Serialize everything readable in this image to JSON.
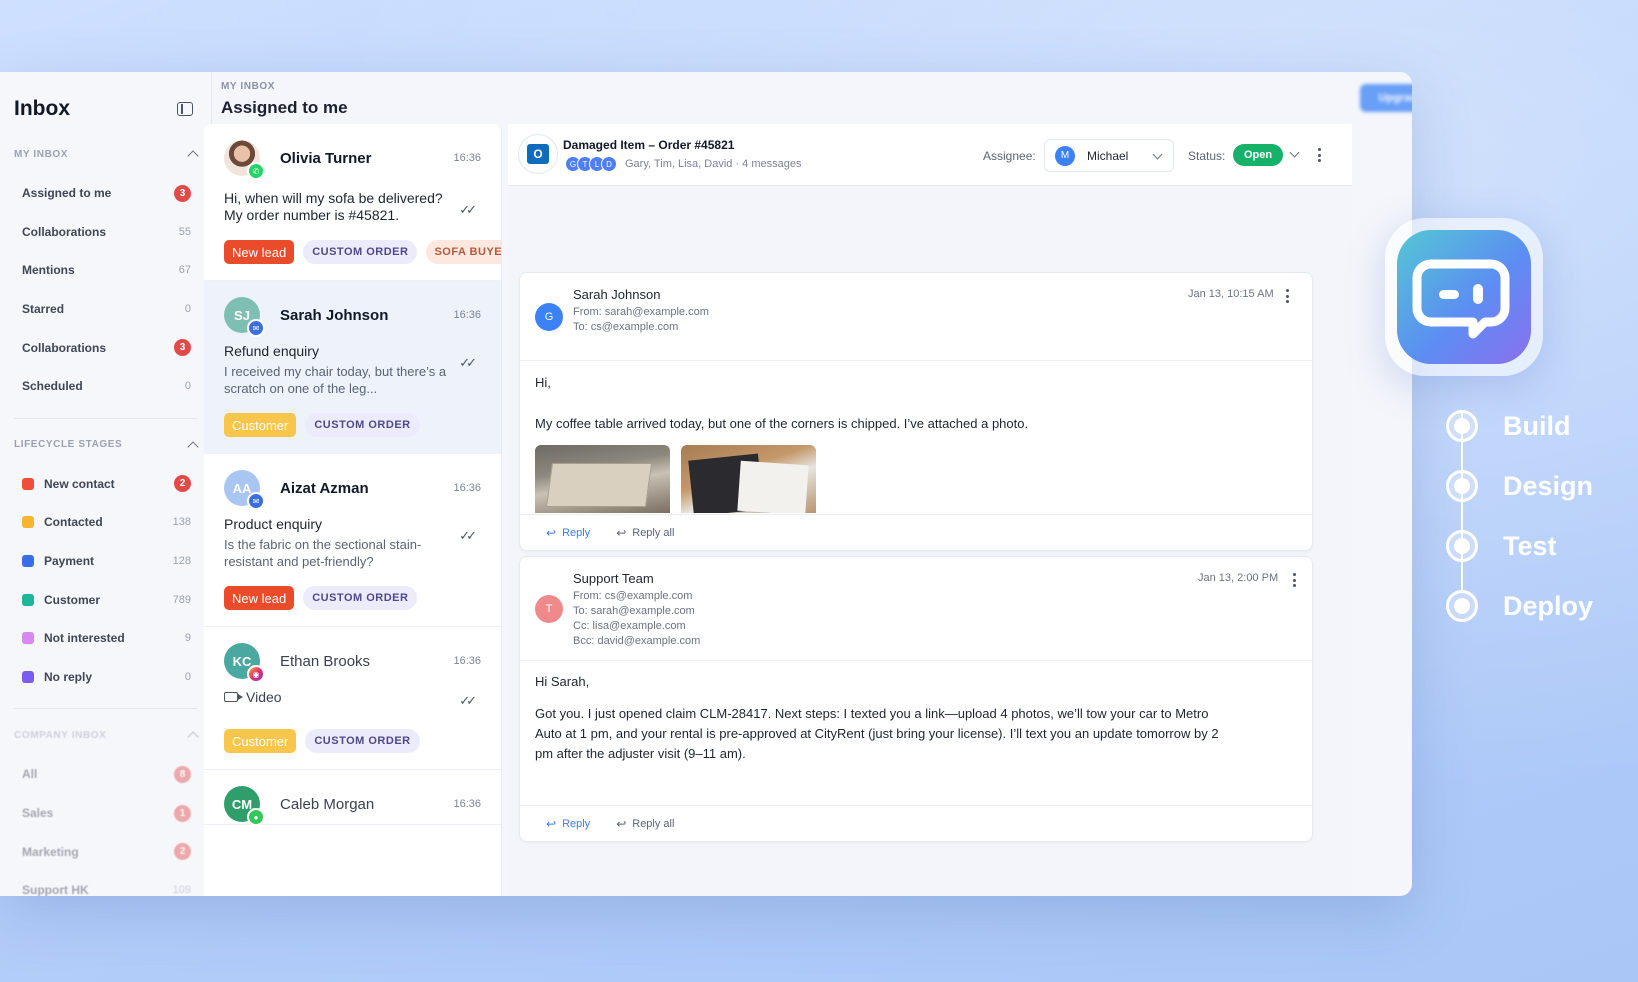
{
  "sidebar": {
    "title": "Inbox",
    "my_inbox": {
      "heading": "MY INBOX",
      "items": [
        {
          "label": "Assigned to me",
          "badge": "3"
        },
        {
          "label": "Collaborations",
          "count": "55"
        },
        {
          "label": "Mentions",
          "count": "67"
        },
        {
          "label": "Starred",
          "count": "0"
        },
        {
          "label": "Collaborations",
          "badge": "3"
        },
        {
          "label": "Scheduled",
          "count": "0"
        }
      ]
    },
    "lifecycle": {
      "heading": "LIFECYCLE STAGES",
      "items": [
        {
          "label": "New contact",
          "badge": "2",
          "color": "#ef4e3a"
        },
        {
          "label": "Contacted",
          "count": "138",
          "color": "#f6b531"
        },
        {
          "label": "Payment",
          "count": "128",
          "color": "#3a6ee8"
        },
        {
          "label": "Customer",
          "count": "789",
          "color": "#1fb59a"
        },
        {
          "label": "Not interested",
          "count": "9",
          "color": "#d68af0"
        },
        {
          "label": "No reply",
          "count": "0",
          "color": "#7b5cf0"
        }
      ]
    },
    "company_inbox": {
      "heading": "COMPANY INBOX",
      "items": [
        {
          "label": "All",
          "badge": "8"
        },
        {
          "label": "Sales",
          "badge": "1"
        },
        {
          "label": "Marketing",
          "badge": "2"
        },
        {
          "label": "Support HK",
          "count": "109"
        }
      ]
    }
  },
  "header": {
    "eyebrow": "MY INBOX",
    "title": "Assigned to me",
    "upgrade_label": "Upgrade Plan"
  },
  "conversations": [
    {
      "name": "Olivia Turner",
      "time": "16:36",
      "preview": "Hi, when will my sofa be delivered? My order number is #45821.",
      "tags": [
        "New lead",
        "CUSTOM ORDER",
        "SOFA BUYER"
      ],
      "channel": "whatsapp-icon"
    },
    {
      "name": "Sarah Johnson",
      "initials": "SJ",
      "time": "16:36",
      "subject": "Refund enquiry",
      "preview": "I received my chair today, but there’s a scratch on one of the leg...",
      "tags": [
        "Customer",
        "CUSTOM ORDER"
      ],
      "channel": "email-icon"
    },
    {
      "name": "Aizat Azman",
      "initials": "AA",
      "time": "16:36",
      "subject": "Product enquiry",
      "preview": "Is the fabric on the sectional stain-resistant and pet-friendly?",
      "tags": [
        "New lead",
        "CUSTOM ORDER"
      ],
      "channel": "email-icon"
    },
    {
      "name": "Ethan Brooks",
      "initials": "KC",
      "time": "16:36",
      "subject": "Video",
      "tags": [
        "Customer",
        "CUSTOM ORDER"
      ],
      "channel": "instagram-icon"
    },
    {
      "name": "Caleb Morgan",
      "initials": "CM",
      "time": "16:36",
      "channel": "imessage-icon"
    }
  ],
  "thread": {
    "subject": "Damaged Item – Order #45821",
    "participants": [
      "G",
      "T",
      "L",
      "D"
    ],
    "participants_meta": "Gary, Tim, Lisa, David · 4 messages",
    "assignee_label": "Assignee:",
    "assignee_initial": "M",
    "assignee_name": "Michael",
    "status_label": "Status:",
    "status_value": "Open",
    "messages": [
      {
        "sender": "Sarah Johnson",
        "avatar": "G",
        "from": "From: sarah@example.com",
        "to": "To: cs@example.com",
        "date": "Jan 13, 10:15 AM",
        "greeting": "Hi,",
        "body": "My coffee table arrived today, but one of the corners is chipped. I’ve attached a photo."
      },
      {
        "sender": "Support Team",
        "avatar": "T",
        "from": "From: cs@example.com",
        "to": "To: sarah@example.com",
        "cc": "Cc: lisa@example.com",
        "bcc": "Bcc: david@example.com",
        "date": "Jan 13, 2:00 PM",
        "greeting": "Hi Sarah,",
        "body": "Got you. I just opened claim CLM-28417. Next steps: I texted you a link—upload 4 photos, we’ll tow your car to Metro Auto at 1 pm, and your rental is pre-approved at CityRent (just bring your license). I’ll text you an update tomorrow by 2 pm after the adjuster visit (9–11 am)."
      }
    ],
    "reply_label": "Reply",
    "reply_all_label": "Reply all"
  },
  "promo": {
    "steps": [
      "Build",
      "Design",
      "Test",
      "Deploy"
    ]
  }
}
